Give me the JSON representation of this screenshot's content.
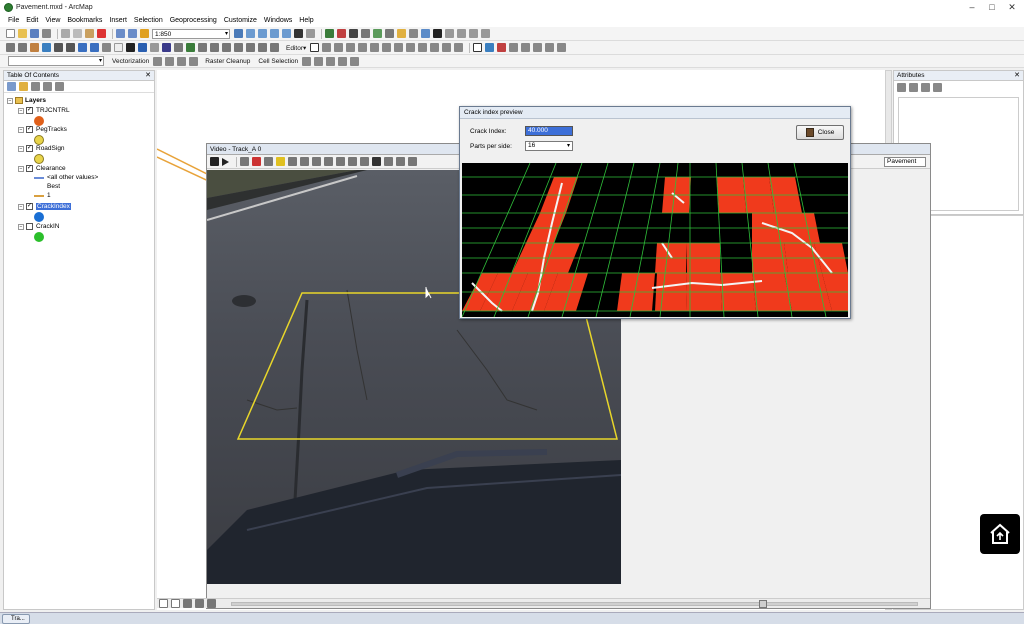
{
  "app": {
    "title": "Pavement.mxd - ArcMap"
  },
  "menu": [
    "File",
    "Edit",
    "View",
    "Bookmarks",
    "Insert",
    "Selection",
    "Geoprocessing",
    "Customize",
    "Windows",
    "Help"
  ],
  "toolbar": {
    "scale": "1:850",
    "editor_label": "Editor▾",
    "vectorization_label": "Vectorization",
    "raster_cleanup_label": "Raster Cleanup",
    "cell_selection_label": "Cell Selection"
  },
  "toc": {
    "title": "Table Of Contents",
    "root": "Layers",
    "layers": [
      {
        "name": "TRJCNTRL",
        "checked": true,
        "color": "#e0601a"
      },
      {
        "name": "PegTracks",
        "checked": true,
        "color": "#e8d44a"
      },
      {
        "name": "RoadSign",
        "checked": true,
        "color": "#e8d44a"
      },
      {
        "name": "Clearance",
        "checked": true,
        "color": ""
      },
      {
        "name": "CrackIndex",
        "checked": true,
        "color": "#1a6fd4"
      },
      {
        "name": "CrackIN",
        "checked": false,
        "color": "#2bbf2b"
      }
    ],
    "clearance_legend": {
      "other": "<all other values>",
      "value_label": "Best",
      "value": "1"
    }
  },
  "attributes": {
    "title": "Attributes"
  },
  "video": {
    "title": "Video - Track_A 0",
    "layer_dropdown": "Pavement"
  },
  "dialog": {
    "title": "Crack index preview",
    "crack_index_label": "Crack Index:",
    "crack_index_value": "40.000",
    "parts_label": "Parts per side:",
    "parts_value": "16",
    "close_label": "Close"
  },
  "taskbar": {
    "item": "Tra..."
  },
  "colors": {
    "crack_cell": "#f03a1c",
    "grid_line": "#2fbf3a",
    "roi_outline": "#e8d62a",
    "selection": "#3d6fd8"
  }
}
